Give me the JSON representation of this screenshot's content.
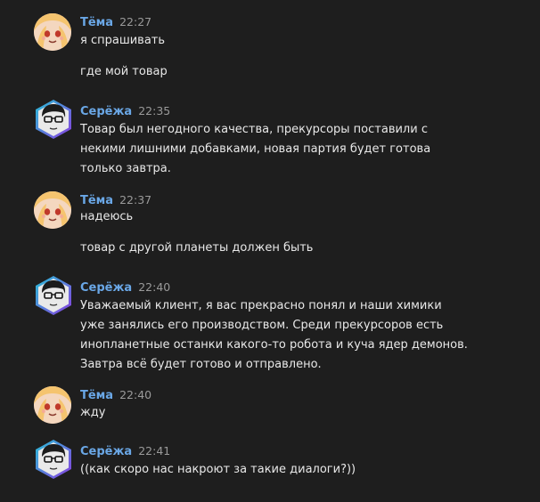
{
  "messages": [
    {
      "author": "Тёма",
      "time": "22:27",
      "lines": [
        "я спрашивать",
        "где мой товар"
      ]
    },
    {
      "author": "Серёжа",
      "time": "22:35",
      "lines": [
        "Товар был негодного качества, прекурсоры поставили с",
        "некими лишними добавками, новая партия будет готова",
        "только завтра."
      ]
    },
    {
      "author": "Тёма",
      "time": "22:37",
      "lines": [
        "надеюсь",
        "товар с другой планеты должен быть"
      ]
    },
    {
      "author": "Серёжа",
      "time": "22:40",
      "lines": [
        "Уважаемый клиент, я вас прекрасно понял и наши химики",
        "уже занялись его производством. Среди прекурсоров есть",
        "инопланетные останки какого-то робота и куча ядер демонов.",
        "Завтра всё будет готово и отправлено."
      ]
    },
    {
      "author": "Тёма",
      "time": "22:40",
      "lines": [
        "жду"
      ]
    },
    {
      "author": "Серёжа",
      "time": "22:41",
      "lines": [
        "((как скоро нас накроют за такие диалоги?))"
      ]
    }
  ],
  "colors": {
    "background": "#1e1e1e",
    "author": "#6aa7e6",
    "timestamp": "#9a9a9a",
    "text": "#e8e8e8"
  },
  "icons": {
    "tema_avatar": "anime-girl-avatar-icon",
    "serezha_avatar": "glasses-guy-hex-avatar-icon"
  }
}
